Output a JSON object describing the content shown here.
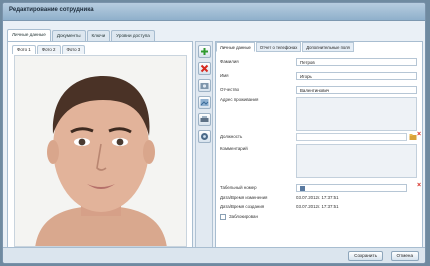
{
  "window": {
    "title": "Редактирование сотрудника"
  },
  "main_tabs": [
    {
      "label": "Личные данные"
    },
    {
      "label": "Документы"
    },
    {
      "label": "Ключи"
    },
    {
      "label": "Уровни доступа"
    }
  ],
  "photo_tabs": [
    {
      "label": "Фото 1"
    },
    {
      "label": "Фото 2"
    },
    {
      "label": "Фото 3"
    }
  ],
  "right_tabs": [
    {
      "label": "Личные данные"
    },
    {
      "label": "Отчет о телефонах"
    },
    {
      "label": "Дополнительные поля"
    }
  ],
  "fields": {
    "lastname_label": "Фамилия",
    "lastname_value": "Петров",
    "firstname_label": "Имя",
    "firstname_value": "Игорь",
    "patronymic_label": "Отчество",
    "patronymic_value": "Валентинович",
    "address_label": "Адрес проживания",
    "position_label": "Должность",
    "comment_label": "Комментарий",
    "tabnum_label": "Табельный номер",
    "changed_label": "Дата/Время изменения",
    "changed_value": "03.07.2012г. 17:37:51",
    "created_label": "Дата/Время создания",
    "created_value": "03.07.2012г. 17:37:51",
    "blocked_label": "Заблокирован"
  },
  "footer": {
    "save_label": "Сохранить",
    "cancel_label": "Отмена"
  },
  "icons": {
    "add": "plus-icon",
    "delete": "red-x-icon"
  }
}
